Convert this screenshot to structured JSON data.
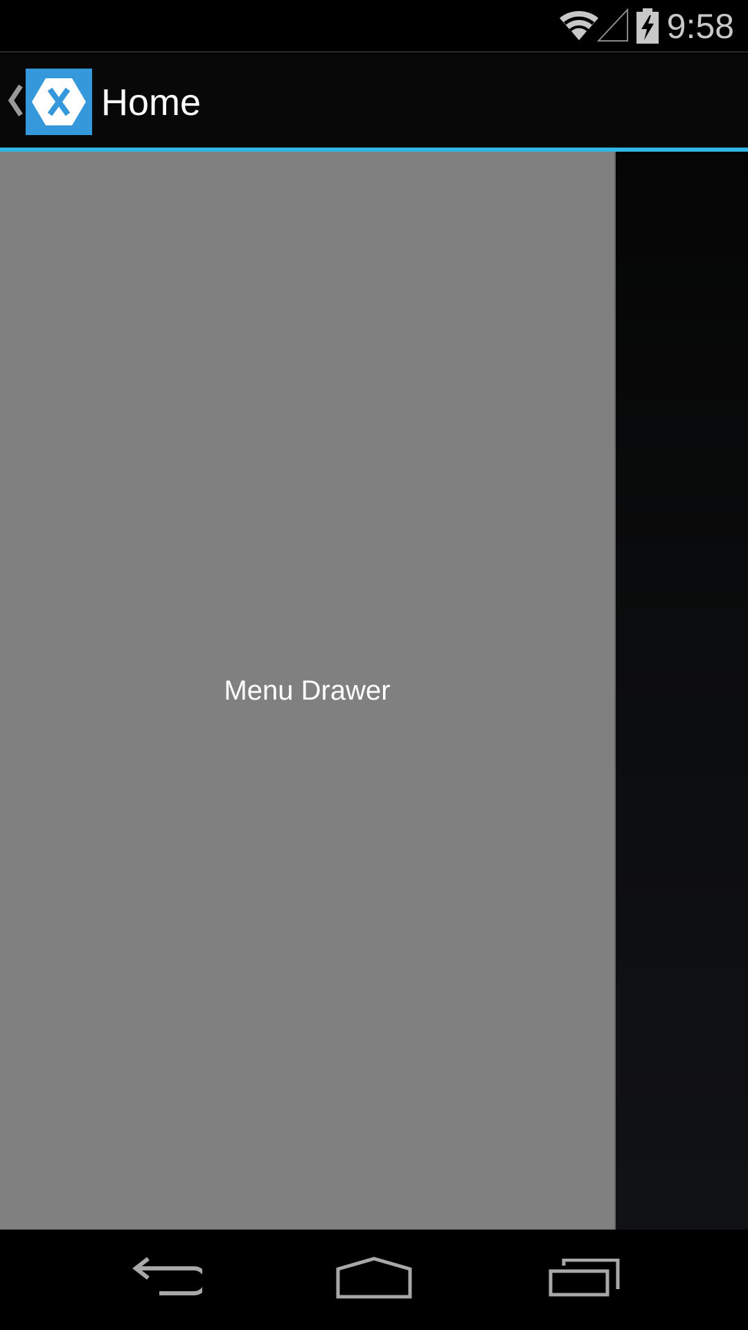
{
  "status_bar": {
    "time": "9:58",
    "icons": [
      "wifi-icon",
      "cell-signal-icon",
      "battery-charging-icon"
    ]
  },
  "action_bar": {
    "title": "Home",
    "up_icon": "chevron-left-icon",
    "app_icon": "xamarin-logo-icon",
    "accent_color": "#33b5e5",
    "app_icon_color": "#3498db"
  },
  "drawer": {
    "label": "Menu Drawer",
    "background_color": "#808080"
  },
  "nav_bar": {
    "buttons": [
      "back-icon",
      "home-icon",
      "recents-icon"
    ]
  }
}
